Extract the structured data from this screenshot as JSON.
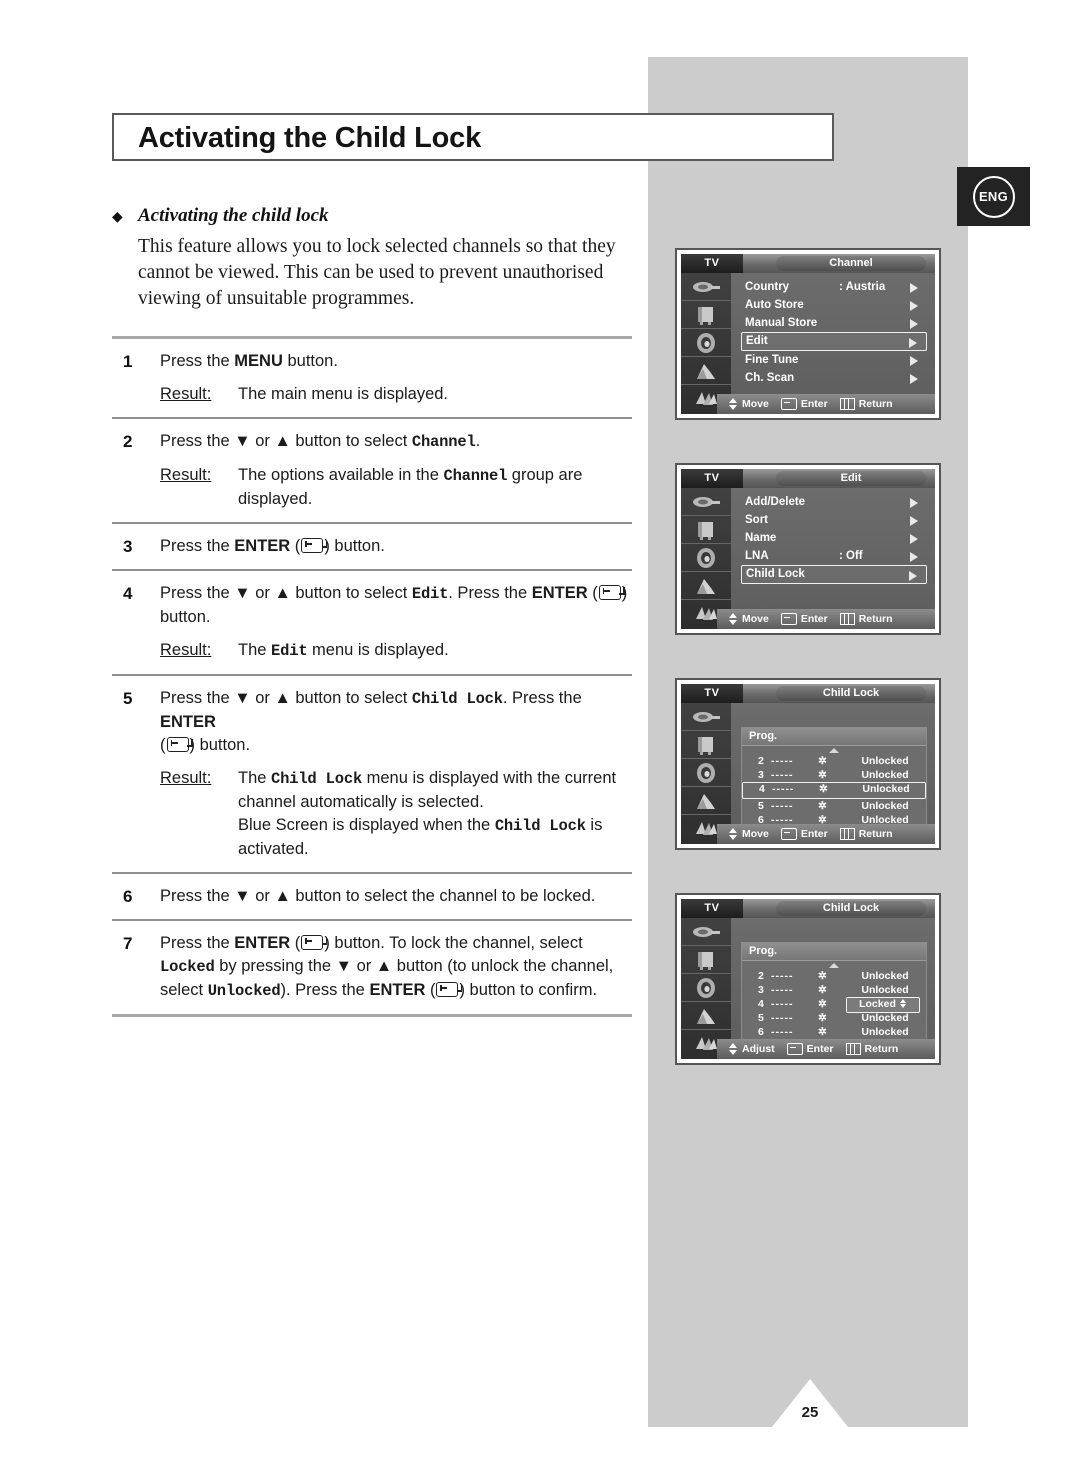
{
  "page": {
    "title": "Activating the Child Lock",
    "lang_badge": "ENG",
    "page_number": "25"
  },
  "section": {
    "bullet_heading": "Activating the child lock",
    "intro": "This feature allows you to lock selected channels so that they cannot be viewed. This can be used to prevent unauthorised viewing of unsuitable programmes."
  },
  "steps": [
    {
      "num": "1",
      "text_parts": [
        "Press the ",
        "MENU",
        " button."
      ],
      "result_label": "Result:",
      "result": "The main menu is displayed."
    },
    {
      "num": "2",
      "text_parts": [
        "Press the ▼ or ▲ button to select ",
        "Channel",
        "."
      ],
      "result_label": "Result:",
      "result": "The options available in the Channel group are displayed."
    },
    {
      "num": "3",
      "text_parts": [
        "Press the ",
        "ENTER",
        " (    ) button."
      ],
      "result_label": "",
      "result": ""
    },
    {
      "num": "4",
      "text_parts": [
        "Press the ▼ or ▲ button to select ",
        "Edit",
        ". Press the ",
        "ENTER",
        " (    ) button."
      ],
      "result_label": "Result:",
      "result": "The Edit menu is displayed."
    },
    {
      "num": "5",
      "text_parts": [
        "Press the ▼ or ▲ button to select ",
        "Child Lock",
        ". Press the ",
        "ENTER",
        " (    ) button."
      ],
      "result_label": "Result:",
      "result": "The Child Lock menu is displayed with the current channel automatically is selected. Blue Screen is displayed when the Child Lock is activated."
    },
    {
      "num": "6",
      "text_parts": [
        "Press the ▼ or ▲ button to select the channel to be locked."
      ],
      "result_label": "",
      "result": ""
    },
    {
      "num": "7",
      "text_parts": [
        "Press the ",
        "ENTER",
        " (    ) button. To lock the channel, select ",
        "Locked",
        " by pressing the ▼ or ▲ button (to unlock the channel, select ",
        "Unlocked",
        "). Press the ",
        "ENTER",
        " (    ) button to confirm."
      ],
      "result_label": "",
      "result": ""
    }
  ],
  "osd_panels": [
    {
      "source_label": "TV",
      "title": "Channel",
      "rows": [
        {
          "label": "Country",
          "value": ": Austria",
          "arrow": true,
          "selected": false
        },
        {
          "label": "Auto Store",
          "value": "",
          "arrow": true,
          "selected": false
        },
        {
          "label": "Manual Store",
          "value": "",
          "arrow": true,
          "selected": false
        },
        {
          "label": "Edit",
          "value": "",
          "arrow": true,
          "selected": true
        },
        {
          "label": "Fine Tune",
          "value": "",
          "arrow": true,
          "selected": false
        },
        {
          "label": "Ch. Scan",
          "value": "",
          "arrow": true,
          "selected": false
        }
      ],
      "footer": {
        "move": "Move",
        "enter": "Enter",
        "return": "Return"
      }
    },
    {
      "source_label": "TV",
      "title": "Edit",
      "rows": [
        {
          "label": "Add/Delete",
          "value": "",
          "arrow": true,
          "selected": false
        },
        {
          "label": "Sort",
          "value": "",
          "arrow": true,
          "selected": false
        },
        {
          "label": "Name",
          "value": "",
          "arrow": true,
          "selected": false
        },
        {
          "label": "LNA",
          "value": ": Off",
          "arrow": true,
          "selected": false
        },
        {
          "label": "Child Lock",
          "value": "",
          "arrow": true,
          "selected": true
        }
      ],
      "footer": {
        "move": "Move",
        "enter": "Enter",
        "return": "Return"
      }
    },
    {
      "source_label": "TV",
      "title": "Child Lock",
      "prog_header": "Prog.",
      "prog_rows": [
        {
          "num": "2",
          "dashes": "-----",
          "star": "✲",
          "state": "Unlocked",
          "selected": false,
          "boxed": false
        },
        {
          "num": "3",
          "dashes": "-----",
          "star": "✲",
          "state": "Unlocked",
          "selected": false,
          "boxed": false
        },
        {
          "num": "4",
          "dashes": "-----",
          "star": "✲",
          "state": "Unlocked",
          "selected": true,
          "boxed": false
        },
        {
          "num": "5",
          "dashes": "-----",
          "star": "✲",
          "state": "Unlocked",
          "selected": false,
          "boxed": false
        },
        {
          "num": "6",
          "dashes": "-----",
          "star": "✲",
          "state": "Unlocked",
          "selected": false,
          "boxed": false
        }
      ],
      "footer": {
        "move": "Move",
        "enter": "Enter",
        "return": "Return"
      }
    },
    {
      "source_label": "TV",
      "title": "Child Lock",
      "prog_header": "Prog.",
      "prog_rows": [
        {
          "num": "2",
          "dashes": "-----",
          "star": "✲",
          "state": "Unlocked",
          "selected": false,
          "boxed": false
        },
        {
          "num": "3",
          "dashes": "-----",
          "star": "✲",
          "state": "Unlocked",
          "selected": false,
          "boxed": false
        },
        {
          "num": "4",
          "dashes": "-----",
          "star": "✲",
          "state": "Locked",
          "selected": false,
          "boxed": true
        },
        {
          "num": "5",
          "dashes": "-----",
          "star": "✲",
          "state": "Unlocked",
          "selected": false,
          "boxed": false
        },
        {
          "num": "6",
          "dashes": "-----",
          "star": "✲",
          "state": "Unlocked",
          "selected": false,
          "boxed": false
        }
      ],
      "footer": {
        "move": "Adjust",
        "enter": "Enter",
        "return": "Return"
      }
    }
  ],
  "icons": {
    "sidebar": [
      "antenna-icon",
      "tv-set-icon",
      "speaker-icon",
      "picture-icon",
      "setup-icon"
    ]
  },
  "colors": {
    "panel_gray": "#cccccc",
    "rule_gray": "#a8a8a8",
    "badge_black": "#232323"
  }
}
